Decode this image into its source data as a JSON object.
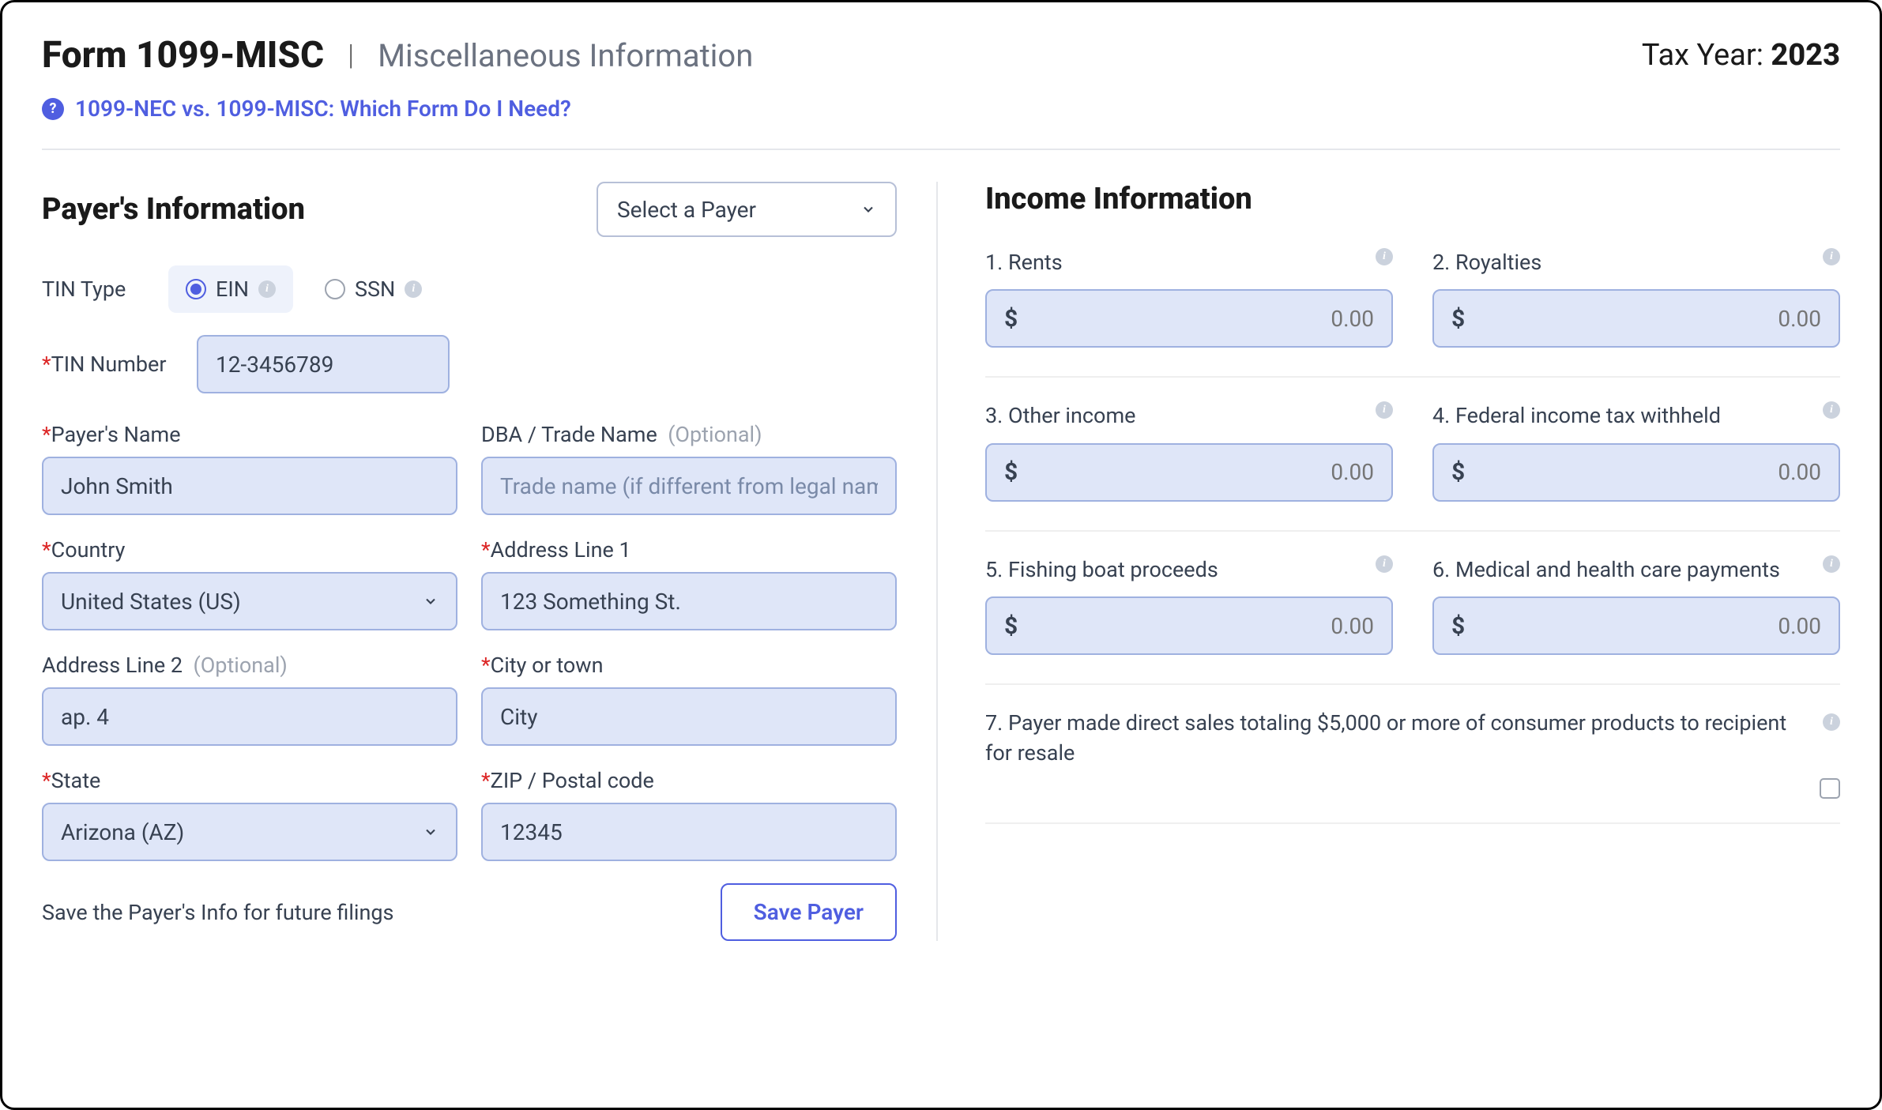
{
  "header": {
    "title": "Form 1099-MISC",
    "subtitle": "Miscellaneous Information",
    "tax_year_label": "Tax Year: ",
    "tax_year": "2023"
  },
  "help_link": "1099-NEC vs. 1099-MISC: Which Form Do I Need?",
  "payer": {
    "section_title": "Payer's Information",
    "select_placeholder": "Select a Payer",
    "tin_type_label": "TIN Type",
    "ein_label": "EIN",
    "ssn_label": "SSN",
    "tin_number_label": "TIN Number",
    "tin_number_value": "12-3456789",
    "name_label": "Payer's Name",
    "name_value": "John Smith",
    "dba_label": "DBA / Trade Name",
    "dba_optional": "(Optional)",
    "dba_placeholder": "Trade name (if different from legal name)",
    "country_label": "Country",
    "country_value": "United States (US)",
    "addr1_label": "Address Line 1",
    "addr1_value": "123 Something St.",
    "addr2_label": "Address Line 2",
    "addr2_optional": "(Optional)",
    "addr2_value": "ap. 4",
    "city_label": "City or town",
    "city_value": "City",
    "state_label": "State",
    "state_value": "Arizona (AZ)",
    "zip_label": "ZIP / Postal code",
    "zip_value": "12345",
    "save_text": "Save the Payer's Info for future filings",
    "save_button": "Save Payer"
  },
  "income": {
    "section_title": "Income Information",
    "box1": "1. Rents",
    "box2": "2. Royalties",
    "box3": "3. Other income",
    "box4": "4. Federal income tax withheld",
    "box5": "5. Fishing boat proceeds",
    "box6": "6. Medical and health care payments",
    "box7": "7. Payer made direct sales totaling $5,000 or more of consumer products to recipient for resale",
    "placeholder": "0.00"
  }
}
